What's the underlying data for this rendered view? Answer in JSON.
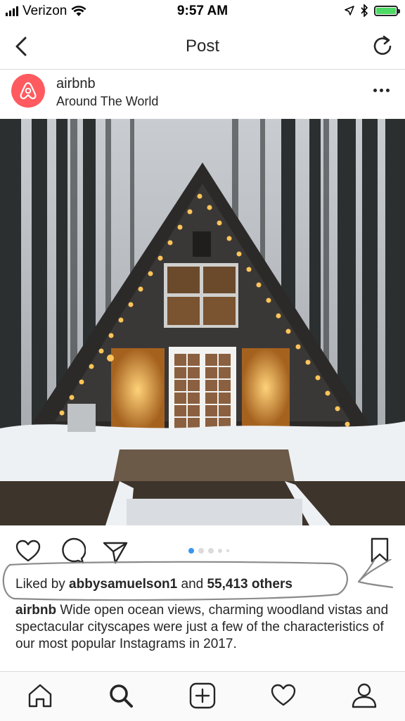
{
  "status_bar": {
    "carrier": "Verizon",
    "time": "9:57 AM",
    "battery_color": "#4cd964"
  },
  "nav": {
    "title": "Post",
    "back_icon": "chevron-left-icon",
    "refresh_icon": "refresh-icon"
  },
  "post": {
    "username": "airbnb",
    "location": "Around The World",
    "avatar_color": "#ff5a5f",
    "image_description_icon": "photo",
    "carousel": {
      "count": 5,
      "active_index": 0
    },
    "likes": {
      "prefix": "Liked by ",
      "user": "abbysamuelson1",
      "middle": " and ",
      "count": "55,413 others"
    },
    "caption": {
      "username": "airbnb",
      "text": " Wide open ocean views, charming woodland vistas and spectacular cityscapes were just a few of the characteristics of our most popular Instagrams in 2017."
    }
  },
  "tab_bar": {
    "items": [
      "home-icon",
      "search-icon",
      "add-icon",
      "heart-icon",
      "profile-icon"
    ],
    "active": "search-icon"
  }
}
